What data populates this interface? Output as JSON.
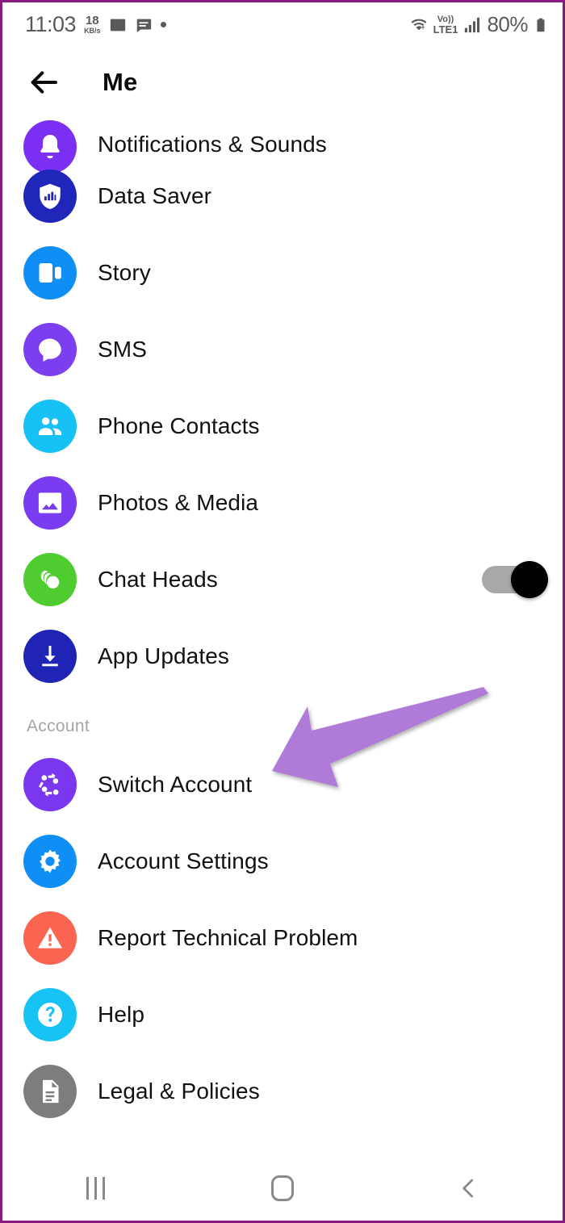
{
  "status_bar": {
    "time": "11:03",
    "net_speed_value": "18",
    "net_speed_unit": "KB/s",
    "icons_left": [
      "photo-icon",
      "message-icon",
      "dot-indicator"
    ],
    "wifi_icon": "wifi-data-icon",
    "volte_top": "Vo))",
    "volte_bottom": "LTE1",
    "signal_icon": "signal-bars-icon",
    "battery_percent": "80%",
    "battery_icon": "battery-icon"
  },
  "header": {
    "back_icon": "back-arrow-icon",
    "title": "Me"
  },
  "list": {
    "items": [
      {
        "label": "Notifications & Sounds",
        "icon": "bell-icon",
        "color": "#7a2ff2",
        "clipped": true,
        "toggle": null
      },
      {
        "label": "Data Saver",
        "icon": "shield-bars-icon",
        "color": "#2126ba",
        "clipped": false,
        "toggle": null
      },
      {
        "label": "Story",
        "icon": "story-icon",
        "color": "#0f8ff5",
        "clipped": false,
        "toggle": null
      },
      {
        "label": "SMS",
        "icon": "chat-bubble-icon",
        "color": "#7b3ff0",
        "clipped": false,
        "toggle": null
      },
      {
        "label": "Phone Contacts",
        "icon": "people-icon",
        "color": "#17c0f5",
        "clipped": false,
        "toggle": null
      },
      {
        "label": "Photos & Media",
        "icon": "image-icon",
        "color": "#7a3cf0",
        "clipped": false,
        "toggle": null
      },
      {
        "label": "Chat Heads",
        "icon": "chat-heads-icon",
        "color": "#4fcc2f",
        "clipped": false,
        "toggle": "on"
      },
      {
        "label": "App Updates",
        "icon": "download-icon",
        "color": "#2024b5",
        "clipped": false,
        "toggle": null
      }
    ],
    "section_account": {
      "title": "Account",
      "items": [
        {
          "label": "Switch Account",
          "icon": "switch-account-icon",
          "color": "#7b36f0"
        },
        {
          "label": "Account Settings",
          "icon": "gear-icon",
          "color": "#0f8ff5"
        },
        {
          "label": "Report Technical Problem",
          "icon": "warning-icon",
          "color": "#fa6450"
        },
        {
          "label": "Help",
          "icon": "question-icon",
          "color": "#17c3f5"
        },
        {
          "label": "Legal & Policies",
          "icon": "document-icon",
          "color": "#7d7d7d"
        }
      ]
    }
  },
  "annotation": {
    "name": "purple-arrow-pointing-to-switch-account",
    "color": "#b07ad8"
  },
  "nav_bar": {
    "recents_label": "recents-icon",
    "home_label": "home-icon",
    "back_label": "back-icon"
  },
  "colors": {
    "frame_border": "#8b1a80",
    "text_primary": "#111111",
    "text_muted": "#a6a6a6",
    "status_text": "#59595b",
    "toggle_track": "#a8a8a8",
    "toggle_knob": "#000000"
  }
}
